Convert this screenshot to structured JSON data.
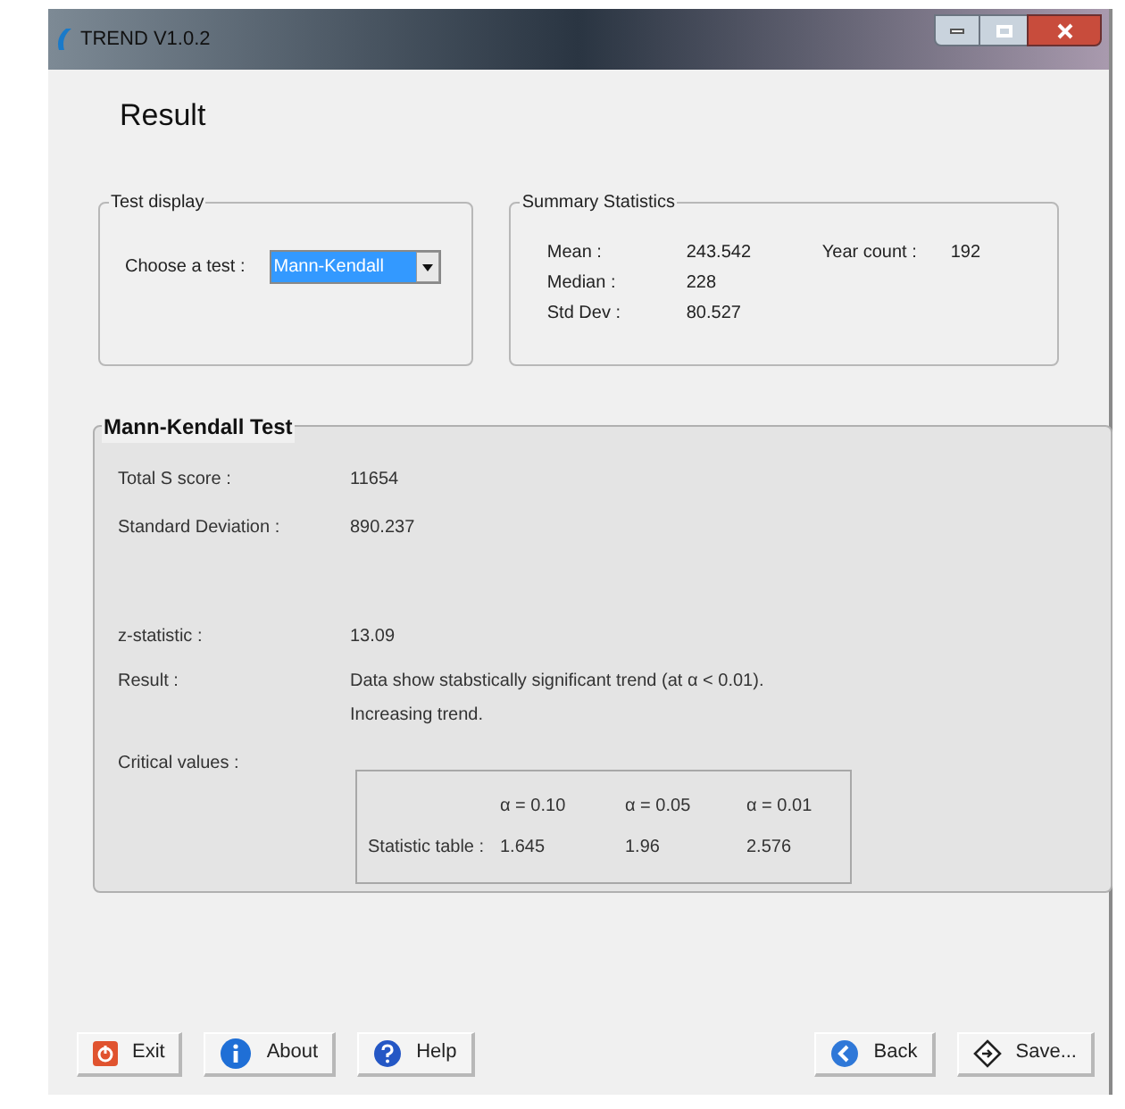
{
  "window": {
    "title": "TREND V1.0.2"
  },
  "heading": "Result",
  "test_display": {
    "title": "Test display",
    "label": "Choose a test :",
    "value": "Mann-Kendall"
  },
  "summary": {
    "title": "Summary Statistics",
    "stats": [
      {
        "label": "Mean :",
        "value": "243.542"
      },
      {
        "label": "Median :",
        "value": "228"
      },
      {
        "label": "Std Dev :",
        "value": "80.527"
      }
    ],
    "year_count": {
      "label": "Year count :",
      "value": "192"
    }
  },
  "test": {
    "title": "Mann-Kendall Test",
    "row_groups": [
      [
        {
          "label": "Total S score :",
          "value": "11654"
        },
        {
          "label": "Standard Deviation :",
          "value": "890.237"
        }
      ],
      [
        {
          "label": "z-statistic :",
          "value": "13.09"
        }
      ]
    ],
    "result": {
      "label": "Result :",
      "lines": [
        "Data show stabstically significant trend (at α < 0.01).",
        "Increasing trend."
      ]
    },
    "critical": {
      "label": "Critical values :",
      "columns": [
        "α = 0.10",
        "α = 0.05",
        "α = 0.01"
      ],
      "row_label": "Statistic table :",
      "values": [
        "1.645",
        "1.96",
        "2.576"
      ]
    }
  },
  "buttons_left": [
    {
      "label": "Exit",
      "kind": "exit"
    },
    {
      "label": "About",
      "kind": "about"
    },
    {
      "label": "Help",
      "kind": "help"
    }
  ],
  "buttons_right": [
    {
      "label": "Back",
      "kind": "back"
    },
    {
      "label": "Save...",
      "kind": "save"
    }
  ]
}
